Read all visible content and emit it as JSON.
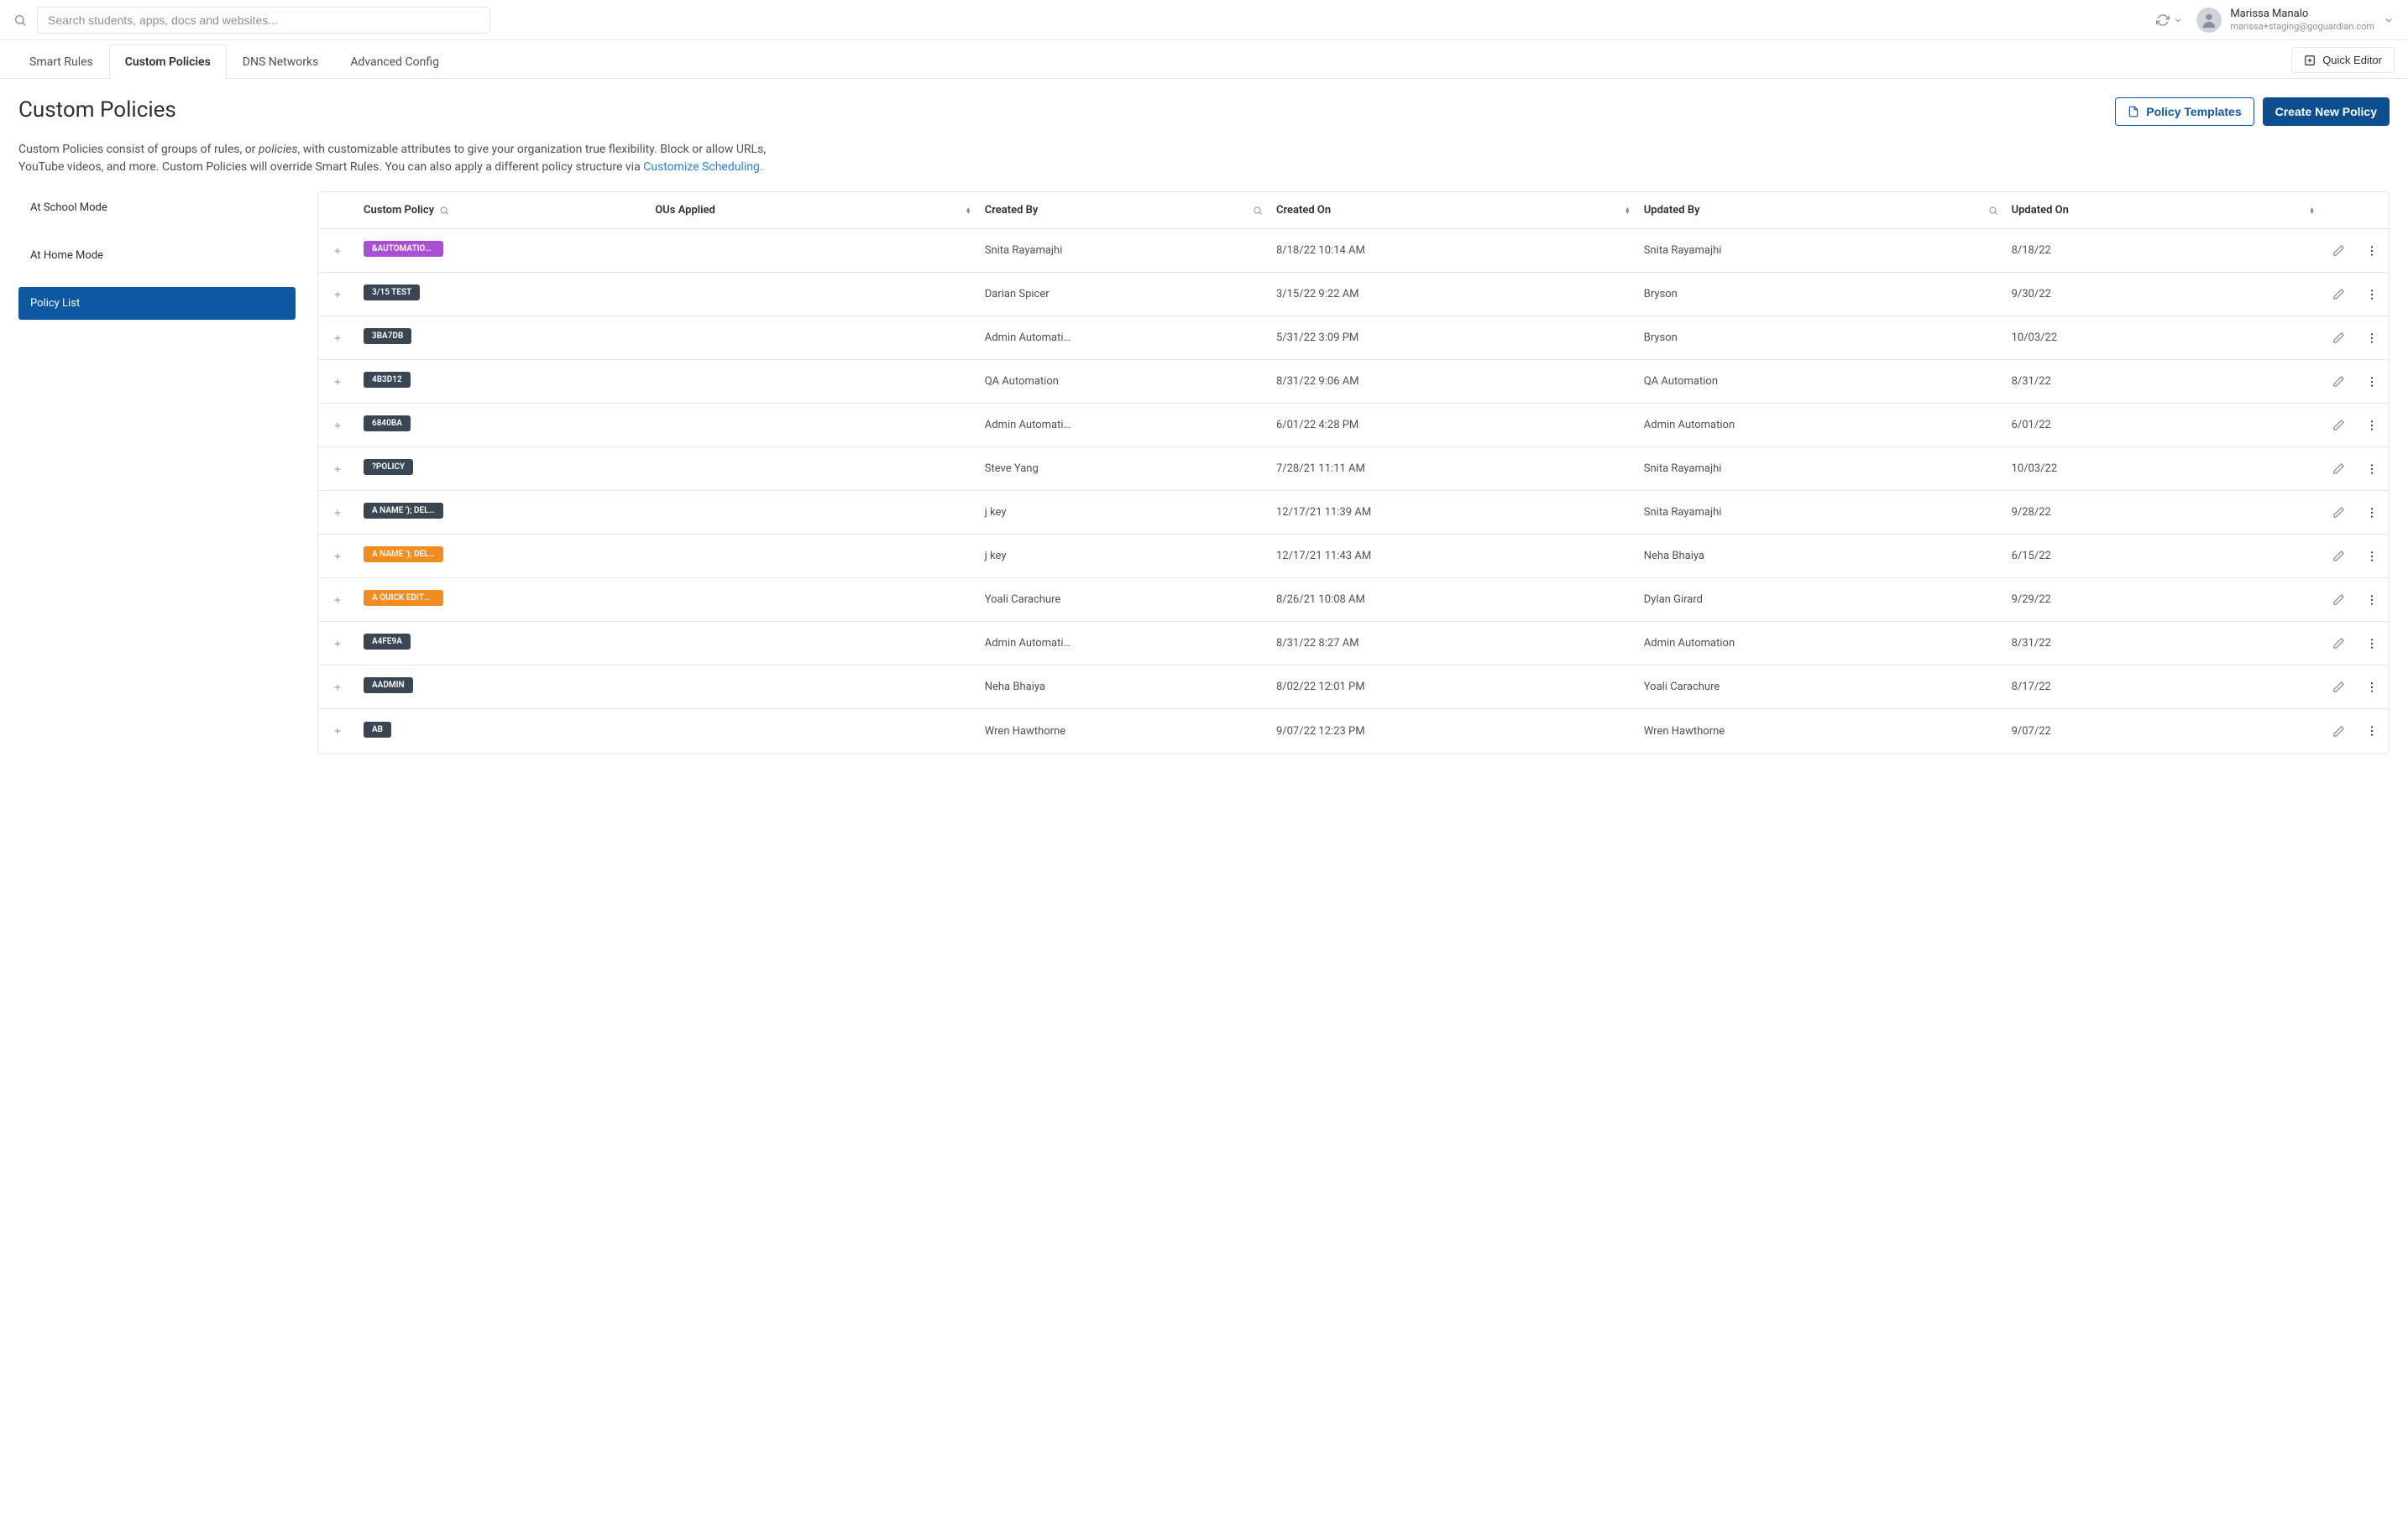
{
  "topbar": {
    "search_placeholder": "Search students, apps, docs and websites...",
    "user_name": "Marissa Manalo",
    "user_email": "marissa+staging@goguardian.com"
  },
  "tabs": [
    {
      "label": "Smart Rules"
    },
    {
      "label": "Custom Policies"
    },
    {
      "label": "DNS Networks"
    },
    {
      "label": "Advanced Config"
    }
  ],
  "active_tab_index": 1,
  "quick_editor_label": "Quick Editor",
  "page_title": "Custom Policies",
  "policy_templates_label": "Policy Templates",
  "create_new_policy_label": "Create New Policy",
  "description_1": "Custom Policies consist of groups of rules, or ",
  "description_em": "policies",
  "description_2": ", with customizable attributes to give your organization true flexibility. Block or allow URLs, YouTube videos, and more. Custom Policies will override Smart Rules. You can also apply a different policy structure via ",
  "description_link": "Customize Scheduling.",
  "sidebar": {
    "items": [
      "At School Mode",
      "At Home Mode",
      "Policy List"
    ],
    "active_index": 2
  },
  "columns": {
    "custom_policy": "Custom Policy",
    "ous_applied": "OUs Applied",
    "created_by": "Created By",
    "created_on": "Created On",
    "updated_by": "Updated By",
    "updated_on": "Updated On"
  },
  "rows": [
    {
      "policy": "&AUTOMATIONPO…",
      "pill": "purple",
      "created_by": "Snita Rayamajhi",
      "created_on": "8/18/22 10:14 AM",
      "updated_by": "Snita Rayamajhi",
      "updated_on": "8/18/22"
    },
    {
      "policy": "3/15 TEST",
      "pill": "dark",
      "created_by": "Darian Spicer",
      "created_on": "3/15/22 9:22 AM",
      "updated_by": "Bryson",
      "updated_on": "9/30/22"
    },
    {
      "policy": "3BA7DB",
      "pill": "dark",
      "created_by": "Admin Automati…",
      "created_on": "5/31/22 3:09 PM",
      "updated_by": "Bryson",
      "updated_on": "10/03/22"
    },
    {
      "policy": "4B3D12",
      "pill": "dark",
      "created_by": "QA Automation",
      "created_on": "8/31/22 9:06 AM",
      "updated_by": "QA Automation",
      "updated_on": "8/31/22"
    },
    {
      "policy": "6840BA",
      "pill": "dark",
      "created_by": "Admin Automati…",
      "created_on": "6/01/22 4:28 PM",
      "updated_by": "Admin Automation",
      "updated_on": "6/01/22"
    },
    {
      "policy": "?POLICY",
      "pill": "dark",
      "created_by": "Steve Yang",
      "created_on": "7/28/21 11:11 AM",
      "updated_by": "Snita Rayamajhi",
      "updated_on": "10/03/22"
    },
    {
      "policy": "A NAME '); DELETE …",
      "pill": "dark",
      "created_by": "j key",
      "created_on": "12/17/21 11:39 AM",
      "updated_by": "Snita Rayamajhi",
      "updated_on": "9/28/22"
    },
    {
      "policy": "A NAME '); DELETE …",
      "pill": "orange",
      "created_by": "j key",
      "created_on": "12/17/21 11:43 AM",
      "updated_by": "Neha Bhaiya",
      "updated_on": "6/15/22"
    },
    {
      "policy": "A QUICK EDITOR T…",
      "pill": "orange",
      "created_by": "Yoali Carachure",
      "created_on": "8/26/21 10:08 AM",
      "updated_by": "Dylan Girard",
      "updated_on": "9/29/22"
    },
    {
      "policy": "A4FE9A",
      "pill": "dark",
      "created_by": "Admin Automati…",
      "created_on": "8/31/22 8:27 AM",
      "updated_by": "Admin Automation",
      "updated_on": "8/31/22"
    },
    {
      "policy": "AADMIN",
      "pill": "dark",
      "created_by": "Neha Bhaiya",
      "created_on": "8/02/22 12:01 PM",
      "updated_by": "Yoali Carachure",
      "updated_on": "8/17/22"
    },
    {
      "policy": "AB",
      "pill": "dark",
      "created_by": "Wren Hawthorne",
      "created_on": "9/07/22 12:23 PM",
      "updated_by": "Wren Hawthorne",
      "updated_on": "9/07/22"
    }
  ]
}
